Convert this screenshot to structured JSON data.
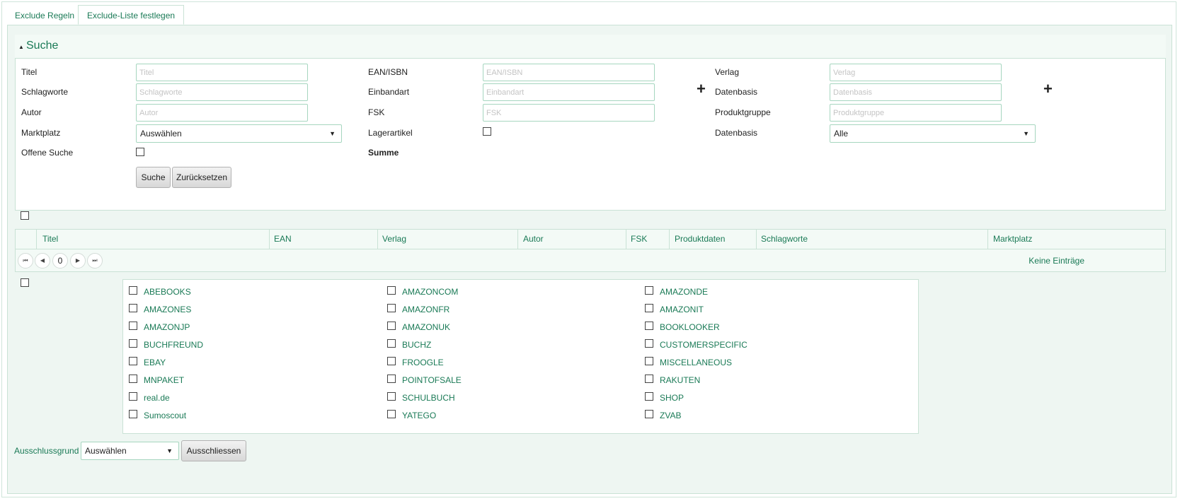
{
  "tabs": [
    {
      "label": "Exclude Regeln"
    },
    {
      "label": "Exclude-Liste festlegen"
    }
  ],
  "search": {
    "title": "Suche",
    "fields": {
      "titel": {
        "label": "Titel",
        "placeholder": "Titel"
      },
      "schlagworte": {
        "label": "Schlagworte",
        "placeholder": "Schlagworte"
      },
      "autor": {
        "label": "Autor",
        "placeholder": "Autor"
      },
      "marktplatz": {
        "label": "Marktplatz",
        "value": "Auswählen"
      },
      "offene_suche": {
        "label": "Offene Suche"
      },
      "ean": {
        "label": "EAN/ISBN",
        "placeholder": "EAN/ISBN"
      },
      "einbandart": {
        "label": "Einbandart",
        "placeholder": "Einbandart"
      },
      "fsk": {
        "label": "FSK",
        "placeholder": "FSK"
      },
      "lagerartikel": {
        "label": "Lagerartikel"
      },
      "summe": {
        "label": "Summe"
      },
      "verlag": {
        "label": "Verlag",
        "placeholder": "Verlag"
      },
      "datenbasis1": {
        "label": "Datenbasis",
        "placeholder": "Datenbasis"
      },
      "produktgruppe": {
        "label": "Produktgruppe",
        "placeholder": "Produktgruppe"
      },
      "datenbasis2": {
        "label": "Datenbasis",
        "value": "Alle"
      }
    },
    "plus_symbol": "+",
    "buttons": {
      "search": "Suche",
      "reset": "Zurücksetzen"
    }
  },
  "grid": {
    "columns": [
      "Titel",
      "EAN",
      "Verlag",
      "Autor",
      "FSK",
      "Produktdaten",
      "Schlagworte",
      "Marktplatz"
    ],
    "pager": {
      "page": "0",
      "empty_text": "Keine Einträge"
    }
  },
  "marketplaces": [
    "ABEBOOKS",
    "AMAZONCOM",
    "AMAZONDE",
    "AMAZONES",
    "AMAZONFR",
    "AMAZONIT",
    "AMAZONJP",
    "AMAZONUK",
    "BOOKLOOKER",
    "BUCHFREUND",
    "BUCHZ",
    "CUSTOMERSPECIFIC",
    "EBAY",
    "FROOGLE",
    "MISCELLANEOUS",
    "MNPAKET",
    "POINTOFSALE",
    "RAKUTEN",
    "real.de",
    "SCHULBUCH",
    "SHOP",
    "Sumoscout",
    "YATEGO",
    "ZVAB"
  ],
  "footer": {
    "reason_label": "Ausschlussgrund",
    "reason_value": "Auswählen",
    "exclude_button": "Ausschliessen"
  },
  "icons": {
    "caret": "▲",
    "dropdown": "▼",
    "first": "⏮",
    "prev": "◀",
    "next": "▶",
    "last": "⏭"
  }
}
